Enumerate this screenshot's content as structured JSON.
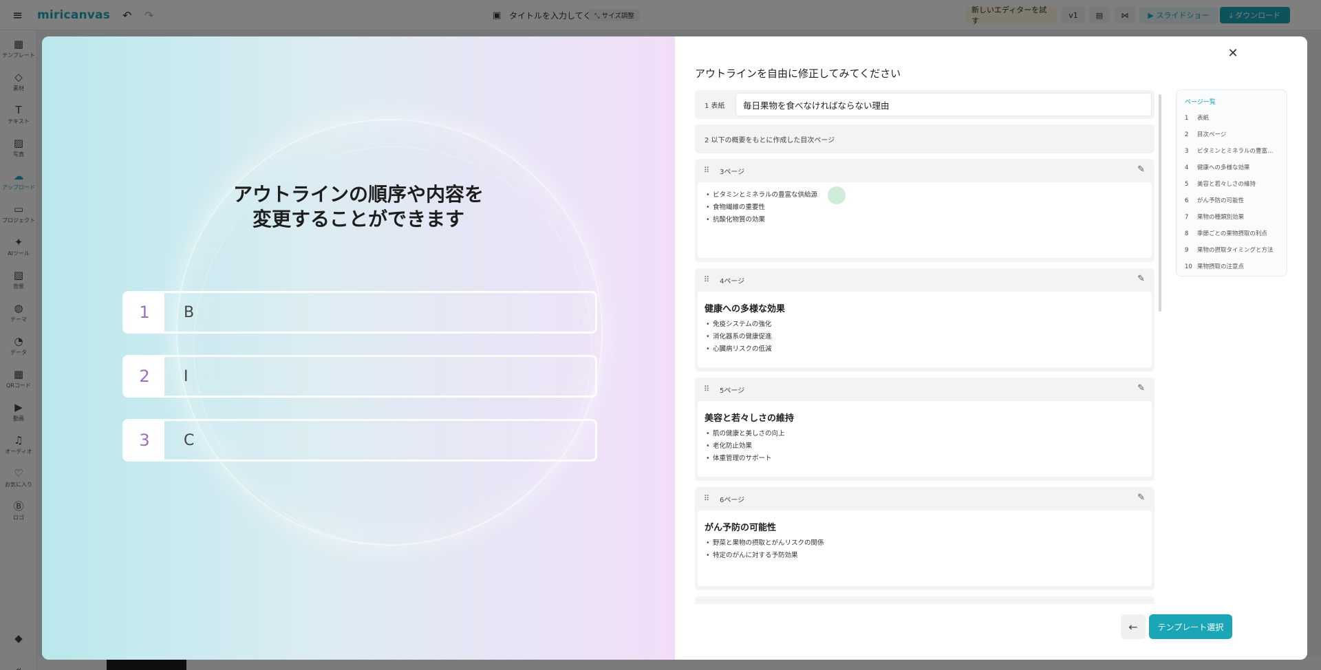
{
  "app": {
    "logo": "miricanvas",
    "menu_icon": "≡",
    "undo_icon": "↶",
    "redo_icon": "↷",
    "doc_icon": "▣",
    "doc_title": "タイトルを入力してく...",
    "resize_label": "⤡ サイズ調整",
    "new_editor": "新しいエディターを試す",
    "version": "v1",
    "save_icon": "▤",
    "share_icon": "⋈",
    "slideshow": "▶ スライドショー",
    "download": "⤓ ダウンロード",
    "collapse_icon": "«",
    "brand_icon": "◆"
  },
  "sidebar": [
    {
      "icon": "▦",
      "label": "テンプレート"
    },
    {
      "icon": "◇",
      "label": "素材"
    },
    {
      "icon": "T",
      "label": "テキスト"
    },
    {
      "icon": "▨",
      "label": "写真"
    },
    {
      "icon": "☁",
      "label": "アップロード"
    },
    {
      "icon": "▭",
      "label": "プロジェクト"
    },
    {
      "icon": "✦",
      "label": "AIツール"
    },
    {
      "icon": "▧",
      "label": "背景"
    },
    {
      "icon": "◍",
      "label": "テーマ"
    },
    {
      "icon": "◔",
      "label": "データ"
    },
    {
      "icon": "▦",
      "label": "QRコード"
    },
    {
      "icon": "▶",
      "label": "動画"
    },
    {
      "icon": "♫",
      "label": "オーディオ"
    },
    {
      "icon": "♡",
      "label": "お気に入り"
    },
    {
      "icon": "Ⓑ",
      "label": "ロゴ"
    }
  ],
  "left": {
    "hero_line1": "アウトラインの順序や内容を",
    "hero_line2": "変更することができます",
    "rows": [
      {
        "num": "1",
        "text": "B"
      },
      {
        "num": "2",
        "text": "I"
      },
      {
        "num": "3",
        "text": "C"
      }
    ]
  },
  "right": {
    "title": "アウトラインを自由に修正してみてください",
    "close_icon": "✕",
    "cover_label": "1  表紙",
    "cover_value": "毎日果物を食べなければならない理由",
    "toc_label": "2  以下の概要をもとに作成した目次ページ",
    "drag_icon": "⠿",
    "edit_icon": "✎",
    "cards": [
      {
        "page": "3ページ",
        "heading": "",
        "bullets": [
          "ビタミンとミネラルの豊富な供給源",
          "食物繊維の重要性",
          "抗酸化物質の効果"
        ]
      },
      {
        "page": "4ページ",
        "heading": "健康への多様な効果",
        "bullets": [
          "免疫システムの強化",
          "消化器系の健康促進",
          "心臓病リスクの低減"
        ]
      },
      {
        "page": "5ページ",
        "heading": "美容と若々しさの維持",
        "bullets": [
          "肌の健康と美しさの向上",
          "老化防止効果",
          "体重管理のサポート"
        ]
      },
      {
        "page": "6ページ",
        "heading": "がん予防の可能性",
        "bullets": [
          "野菜と果物の摂取とがんリスクの関係",
          "特定のがんに対する予防効果"
        ]
      }
    ],
    "pagelist": {
      "title": "ページ一覧",
      "items": [
        {
          "n": "1",
          "label": "表紙"
        },
        {
          "n": "2",
          "label": "目次ページ"
        },
        {
          "n": "3",
          "label": "ビタミンとミネラルの豊富な..."
        },
        {
          "n": "4",
          "label": "健康への多様な効果"
        },
        {
          "n": "5",
          "label": "美容と若々しさの維持"
        },
        {
          "n": "6",
          "label": "がん予防の可能性"
        },
        {
          "n": "7",
          "label": "果物の種類別効果"
        },
        {
          "n": "8",
          "label": "季節ごとの果物摂取の利点"
        },
        {
          "n": "9",
          "label": "果物の摂取タイミングと方法"
        },
        {
          "n": "10",
          "label": "果物摂取の注意点"
        }
      ]
    },
    "back_icon": "←",
    "select_label": "テンプレート選択"
  }
}
